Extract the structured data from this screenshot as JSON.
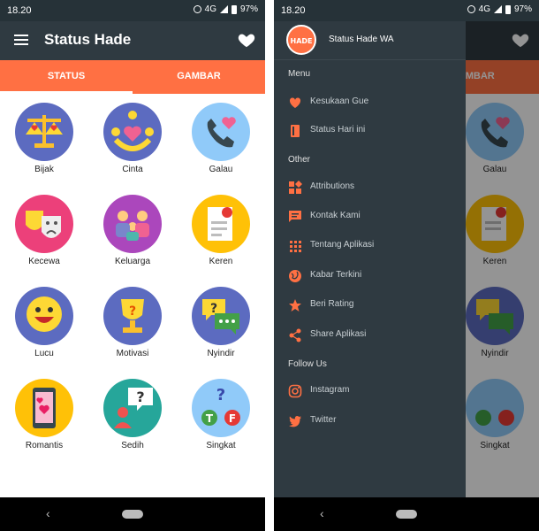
{
  "status_bar": {
    "time": "18.20",
    "network": "4G",
    "battery": "97%"
  },
  "app": {
    "title": "Status Hade",
    "drawer_title": "Status Hade WA",
    "logo_text": "HADE"
  },
  "tabs": [
    {
      "label": "STATUS"
    },
    {
      "label": "GAMBAR"
    }
  ],
  "categories": [
    {
      "label": "Bijak",
      "icon": "scale-icon"
    },
    {
      "label": "Cinta",
      "icon": "love-icon"
    },
    {
      "label": "Galau",
      "icon": "phone-heart-icon"
    },
    {
      "label": "Kecewa",
      "icon": "theatre-masks-icon"
    },
    {
      "label": "Keluarga",
      "icon": "family-icon"
    },
    {
      "label": "Keren",
      "icon": "grade-paper-icon"
    },
    {
      "label": "Lucu",
      "icon": "smiley-icon"
    },
    {
      "label": "Motivasi",
      "icon": "trophy-icon"
    },
    {
      "label": "Nyindir",
      "icon": "chat-bubbles-icon"
    },
    {
      "label": "Romantis",
      "icon": "smartphone-hearts-icon"
    },
    {
      "label": "Sedih",
      "icon": "question-person-icon"
    },
    {
      "label": "Singkat",
      "icon": "true-false-icon"
    }
  ],
  "drawer": {
    "menu_header": "Menu",
    "menu": [
      {
        "label": "Kesukaan Gue",
        "icon": "heart-icon"
      },
      {
        "label": "Status Hari ini",
        "icon": "book-icon"
      }
    ],
    "other_header": "Other",
    "other": [
      {
        "label": "Attributions",
        "icon": "widgets-icon"
      },
      {
        "label": "Kontak Kami",
        "icon": "message-icon"
      },
      {
        "label": "Tentang Aplikasi",
        "icon": "apps-grid-icon"
      },
      {
        "label": "Kabar Terkini",
        "icon": "globe-icon"
      },
      {
        "label": "Beri Rating",
        "icon": "star-icon"
      },
      {
        "label": "Share Aplikasi",
        "icon": "share-icon"
      }
    ],
    "follow_header": "Follow Us",
    "follow": [
      {
        "label": "Instagram",
        "icon": "instagram-icon"
      },
      {
        "label": "Twitter",
        "icon": "twitter-icon"
      }
    ]
  },
  "colors": {
    "accent": "#ff7043",
    "appbar": "#2f3a41",
    "drawer_icon": "#ff7043"
  }
}
